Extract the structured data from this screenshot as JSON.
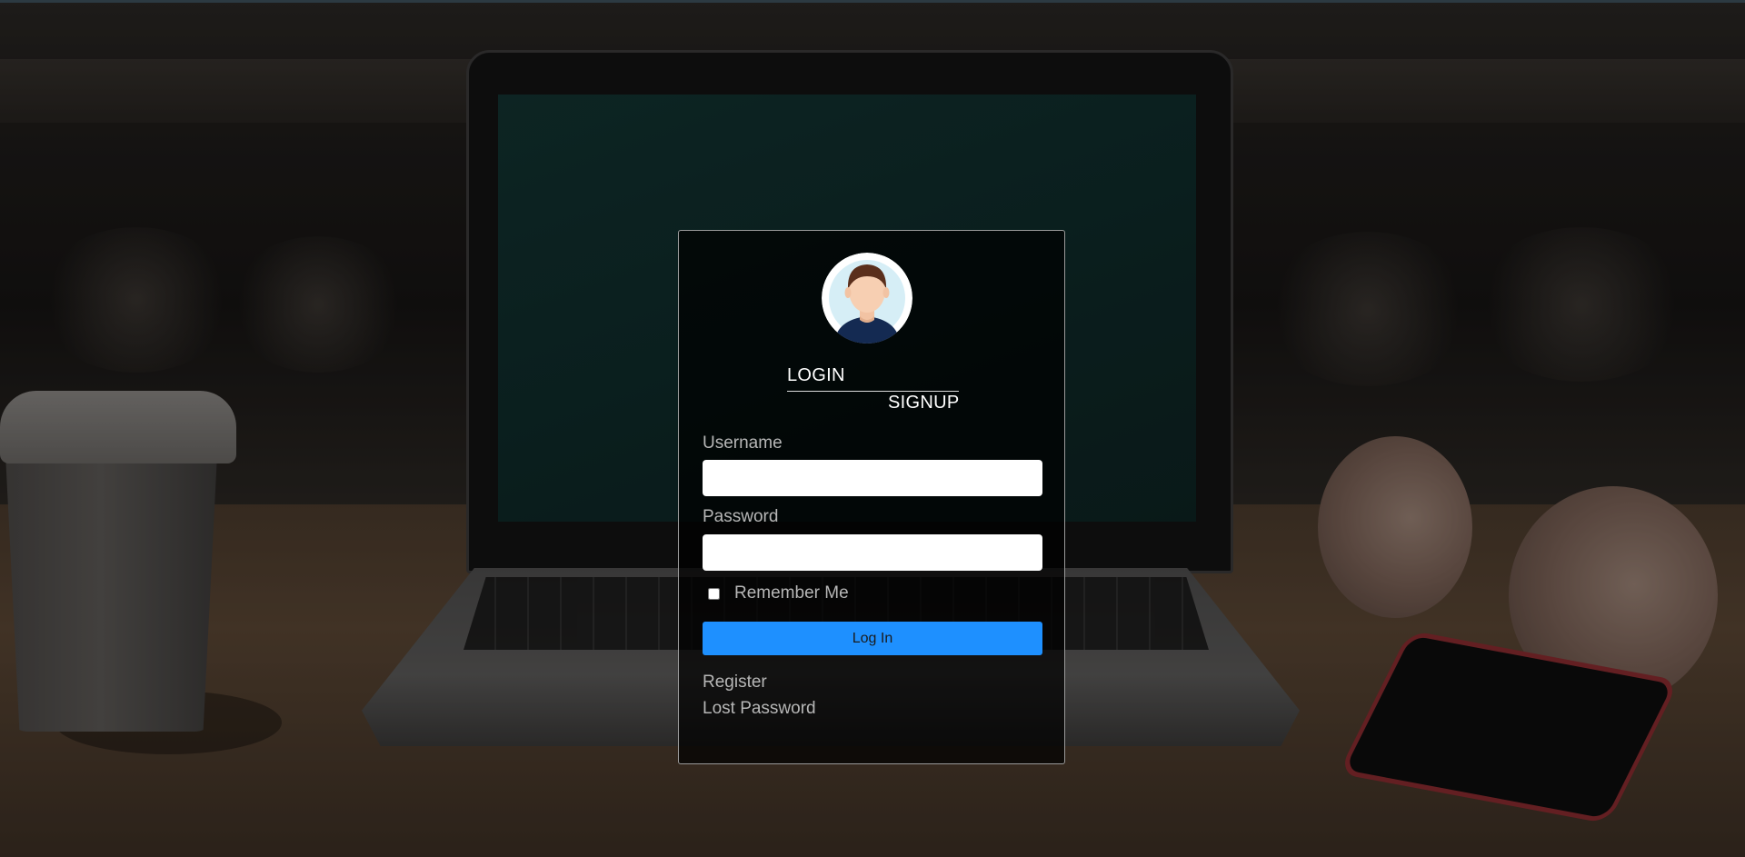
{
  "tabs": {
    "login": "LOGIN",
    "signup": "SIGNUP"
  },
  "form": {
    "username_label": "Username",
    "username_value": "",
    "password_label": "Password",
    "password_value": "",
    "remember_label": "Remember Me",
    "remember_checked": false,
    "submit_label": "Log In"
  },
  "links": {
    "register": "Register",
    "lost_password": "Lost Password"
  },
  "colors": {
    "accent": "#1e90ff",
    "card_background": "rgba(0,0,0,0.72)",
    "label_text": "#b7b7b7"
  },
  "icons": {
    "avatar": "user-avatar-icon"
  }
}
